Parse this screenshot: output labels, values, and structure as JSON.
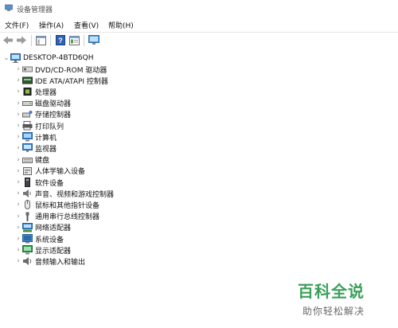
{
  "window": {
    "title": "设备管理器"
  },
  "menu": [
    "文件(F)",
    "操作(A)",
    "查看(V)",
    "帮助(H)"
  ],
  "toolbar": {
    "buttons": [
      "back-arrow-icon",
      "forward-arrow-icon",
      "show-hide-tree-icon",
      "help-icon",
      "properties-icon",
      "scan-hardware-icon"
    ]
  },
  "tree": {
    "root": "DESKTOP-4BTD6QH",
    "items": [
      {
        "label": "DVD/CD-ROM 驱动器",
        "icon": "dvd-drive-icon"
      },
      {
        "label": "IDE ATA/ATAPI 控制器",
        "icon": "ide-controller-icon"
      },
      {
        "label": "处理器",
        "icon": "processor-icon"
      },
      {
        "label": "磁盘驱动器",
        "icon": "disk-drive-icon"
      },
      {
        "label": "存储控制器",
        "icon": "storage-controller-icon"
      },
      {
        "label": "打印队列",
        "icon": "printer-icon"
      },
      {
        "label": "计算机",
        "icon": "computer-icon"
      },
      {
        "label": "监视器",
        "icon": "monitor-icon"
      },
      {
        "label": "键盘",
        "icon": "keyboard-icon"
      },
      {
        "label": "人体学输入设备",
        "icon": "hid-icon"
      },
      {
        "label": "软件设备",
        "icon": "software-device-icon"
      },
      {
        "label": "声音、视频和游戏控制器",
        "icon": "sound-icon"
      },
      {
        "label": "鼠标和其他指针设备",
        "icon": "mouse-icon"
      },
      {
        "label": "通用串行总线控制器",
        "icon": "usb-icon"
      },
      {
        "label": "网络适配器",
        "icon": "network-adapter-icon"
      },
      {
        "label": "系统设备",
        "icon": "system-device-icon"
      },
      {
        "label": "显示适配器",
        "icon": "display-adapter-icon"
      },
      {
        "label": "音频输入和输出",
        "icon": "audio-io-icon"
      }
    ]
  },
  "watermark": {
    "main": "百科全说",
    "sub": "助你轻松解决"
  },
  "colors": {
    "watermark_green": "#3aa05a",
    "watermark_gray": "#6a6a6a"
  }
}
